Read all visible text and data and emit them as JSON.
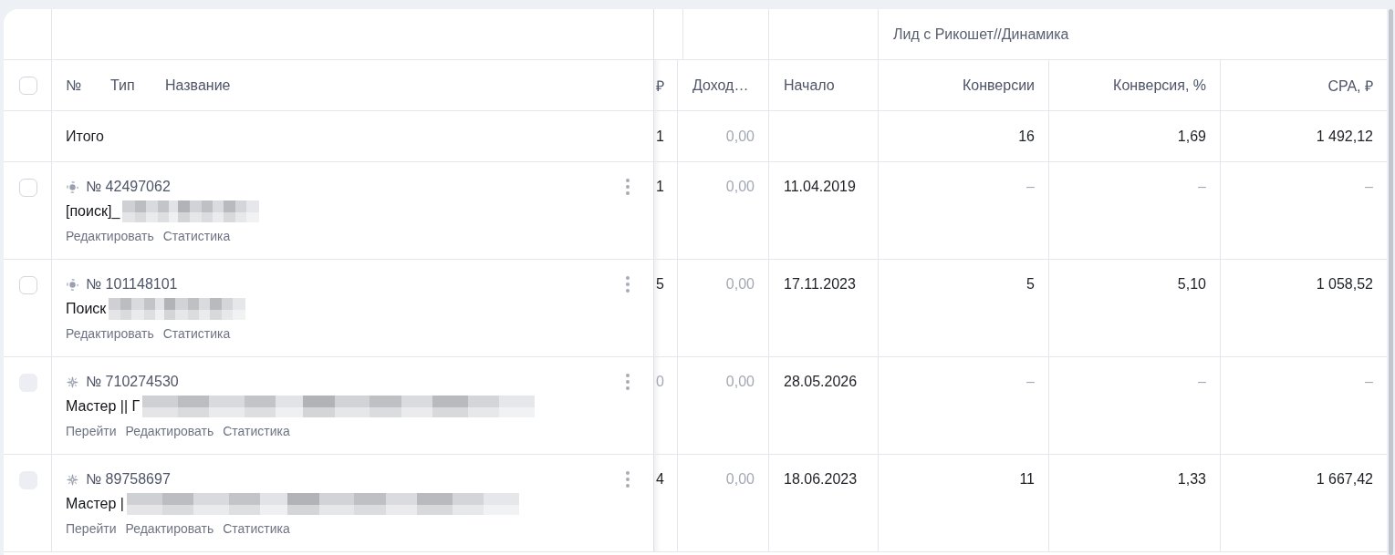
{
  "table": {
    "group_header": "Лид с Рикошет//Динамика",
    "select_all": {
      "checked": false
    },
    "name_headers": [
      "№",
      "Тип",
      "Название"
    ],
    "columns": {
      "column_3": "₽",
      "income": "Доход…",
      "start": "Начало",
      "conversions": "Конверсии",
      "conversion_rate": "Конверсия, %",
      "cpa": "CPA, ₽"
    },
    "total_row": {
      "label": "Итого",
      "column_3": {
        "text": "1",
        "muted": false
      },
      "income": {
        "text": "0,00",
        "muted": true
      },
      "conversions": {
        "text": "16",
        "muted": false
      },
      "conversion_rate": {
        "text": "1,69",
        "muted": false
      },
      "cpa": {
        "text": "1 492,12",
        "muted": false
      }
    },
    "rows": [
      {
        "checked": false,
        "disabled": false,
        "kind": "search",
        "number": "№ 42497062",
        "name": "[поиск]_",
        "redacted": true,
        "actions": [
          "Редактировать",
          "Статистика"
        ],
        "column_3": {
          "text": "1",
          "muted": false
        },
        "income": {
          "text": "0,00",
          "muted": true
        },
        "start": {
          "text": "11.04.2019",
          "muted": false
        },
        "conversions": {
          "text": "–",
          "muted": true
        },
        "conversion_rate": {
          "text": "–",
          "muted": true
        },
        "cpa": {
          "text": "–",
          "muted": true
        }
      },
      {
        "checked": false,
        "disabled": false,
        "kind": "search",
        "number": "№ 101148101",
        "name": "Поиск",
        "redacted": true,
        "actions": [
          "Редактировать",
          "Статистика"
        ],
        "column_3": {
          "text": "5",
          "muted": false
        },
        "income": {
          "text": "0,00",
          "muted": true
        },
        "start": {
          "text": "17.11.2023",
          "muted": false
        },
        "conversions": {
          "text": "5",
          "muted": false
        },
        "conversion_rate": {
          "text": "5,10",
          "muted": false
        },
        "cpa": {
          "text": "1 058,52",
          "muted": false
        }
      },
      {
        "checked": false,
        "disabled": true,
        "kind": "master",
        "number": "№ 710274530",
        "name": "Мастер || Г",
        "redacted": true,
        "actions": [
          "Перейти",
          "Редактировать",
          "Статистика"
        ],
        "column_3": {
          "text": "0",
          "muted": true
        },
        "income": {
          "text": "0,00",
          "muted": true
        },
        "start": {
          "text": "28.05.2026",
          "muted": false
        },
        "conversions": {
          "text": "–",
          "muted": true
        },
        "conversion_rate": {
          "text": "–",
          "muted": true
        },
        "cpa": {
          "text": "–",
          "muted": true
        }
      },
      {
        "checked": false,
        "disabled": true,
        "kind": "master",
        "number": "№ 89758697",
        "name": "Мастер |",
        "redacted": true,
        "actions": [
          "Перейти",
          "Редактировать",
          "Статистика"
        ],
        "column_3": {
          "text": "4",
          "muted": false
        },
        "income": {
          "text": "0,00",
          "muted": true
        },
        "start": {
          "text": "18.06.2023",
          "muted": false
        },
        "conversions": {
          "text": "11",
          "muted": false
        },
        "conversion_rate": {
          "text": "1,33",
          "muted": false
        },
        "cpa": {
          "text": "1 667,42",
          "muted": false
        }
      }
    ]
  }
}
